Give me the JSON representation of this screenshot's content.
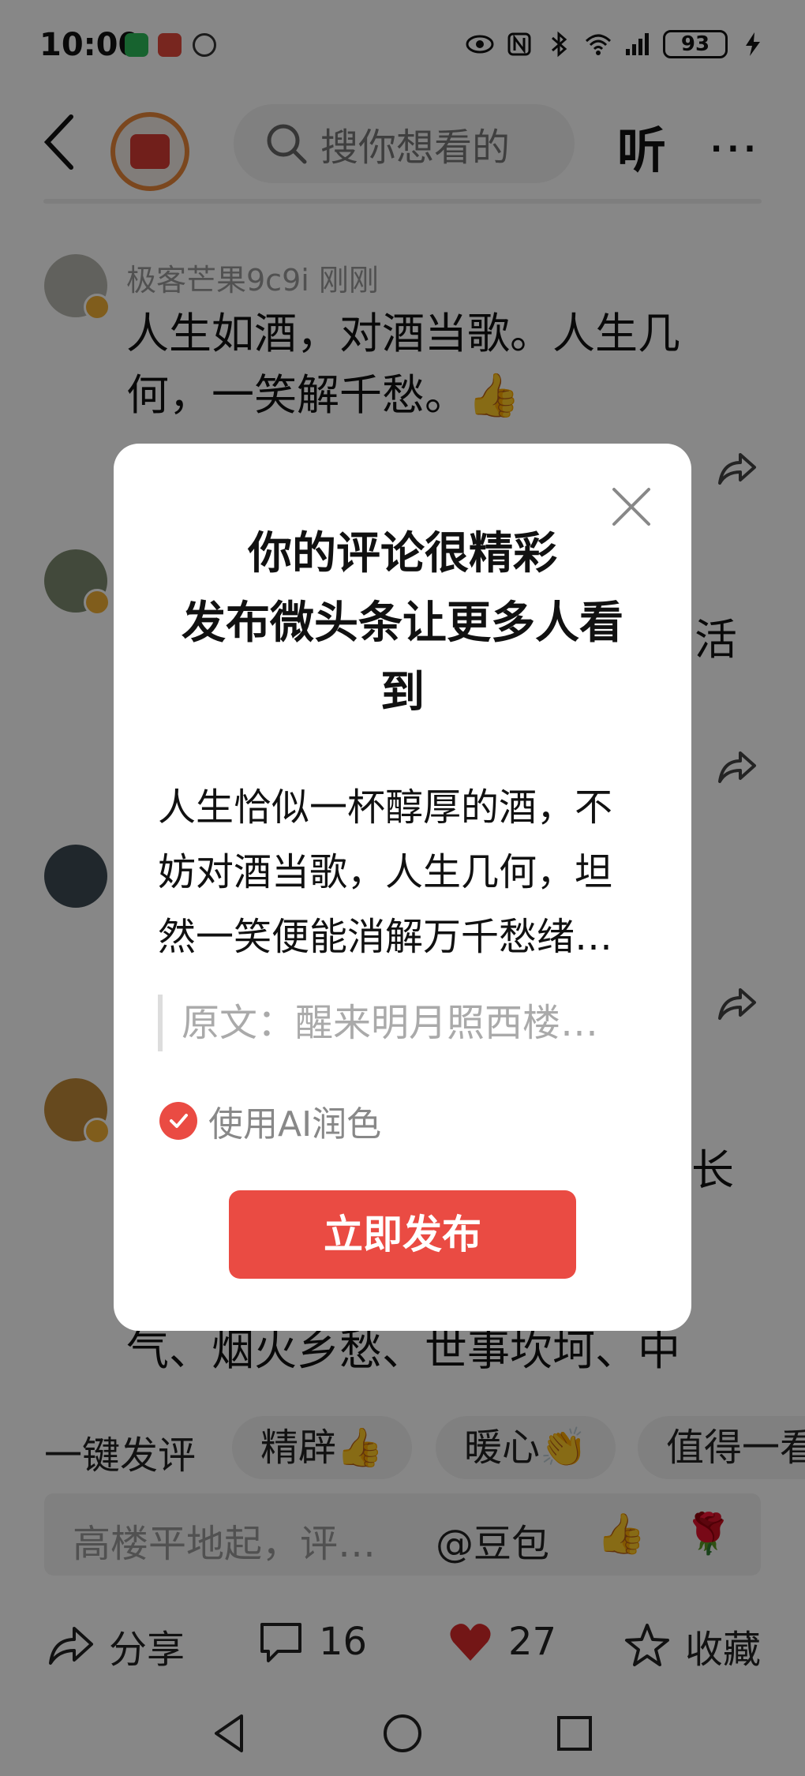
{
  "status_bar": {
    "time": "10:00",
    "battery": "93"
  },
  "header": {
    "search_placeholder": "搜你想看的",
    "listen_label": "听",
    "more_label": "···"
  },
  "comments": [
    {
      "meta": "极客芒果9c9i  刚刚",
      "text": "人生如酒，对酒当歌。人生几何，一笑解千愁。👍"
    },
    {
      "peek_text": "活"
    },
    {
      "peek_text": "长"
    },
    {
      "peek_bottom": "气、烟火乡愁、世事坎坷、中"
    }
  ],
  "quick_tags": {
    "label": "一键发评",
    "items": [
      "精辟👍",
      "暖心👏",
      "值得一看"
    ]
  },
  "input": {
    "placeholder": "高楼平地起，评…",
    "mention": "@豆包",
    "emoji1": "👍",
    "emoji2": "🌹"
  },
  "actions": {
    "share": "分享",
    "comments": "16",
    "likes": "27",
    "collect": "收藏"
  },
  "dialog": {
    "title_line1": "你的评论很精彩",
    "title_line2": "发布微头条让更多人看到",
    "body": "人生恰似一杯醇厚的酒，不妨对酒当歌，人生几何，坦然一笑便能消解万千愁绪…",
    "quote": "原文：醒来明月照西楼…",
    "checkbox_label": "使用AI润色",
    "publish_button": "立即发布"
  },
  "colors": {
    "accent": "#ea4b43",
    "heart": "#d92a2a"
  }
}
